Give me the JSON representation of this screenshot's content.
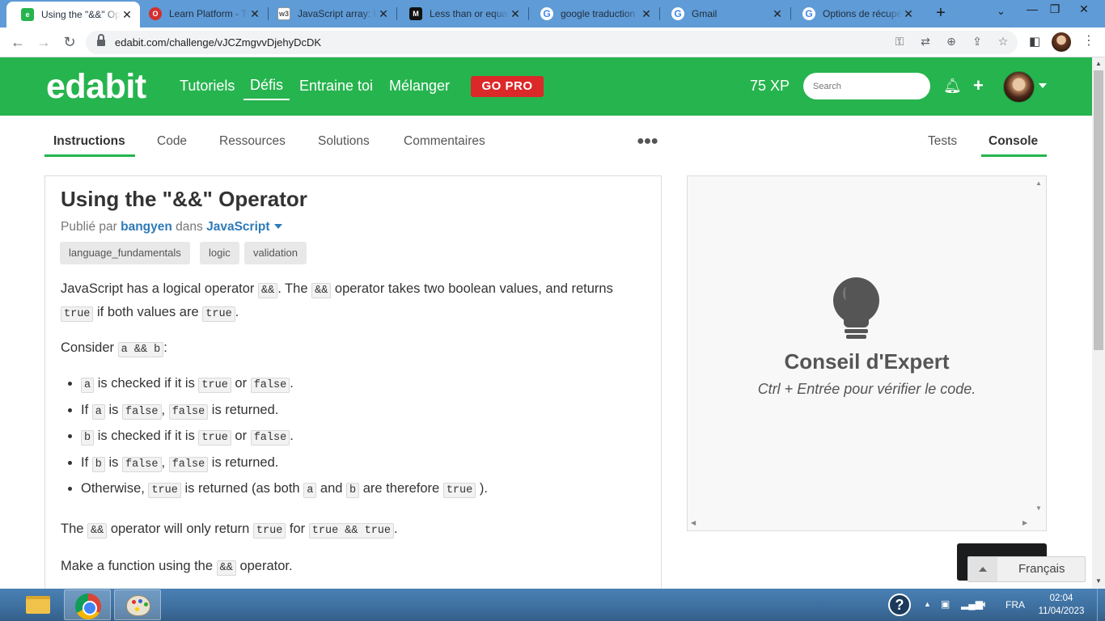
{
  "browser": {
    "tabs": [
      {
        "title": "Using the \"&&\" Operator | edabit",
        "favicon_color": "#26b44e",
        "favicon_glyph": "e",
        "active": true
      },
      {
        "title": "Learn Platform - Third",
        "favicon_color": "#d32f2f",
        "favicon_glyph": "O",
        "active": false
      },
      {
        "title": "JavaScript array: Print",
        "favicon_color": "#9e9e9e",
        "favicon_glyph": "w3",
        "active": false
      },
      {
        "title": "Less than or equal",
        "favicon_color": "#111111",
        "favicon_glyph": "M",
        "active": false
      },
      {
        "title": "google traduction",
        "favicon_color": "#4285f4",
        "favicon_glyph": "G",
        "active": false
      },
      {
        "title": "Gmail",
        "favicon_color": "#4285f4",
        "favicon_glyph": "G",
        "active": false
      },
      {
        "title": "Options de récupération",
        "favicon_color": "#4285f4",
        "favicon_glyph": "G",
        "active": false
      }
    ],
    "url": "edabit.com/challenge/vJCZmgvvDjehyDcDK"
  },
  "site": {
    "logo": "edabit",
    "nav": [
      "Tutoriels",
      "Défis",
      "Entraine toi",
      "Mélanger"
    ],
    "nav_active_index": 1,
    "gopro": "GO PRO",
    "xp": "75 XP",
    "search_placeholder": "Search"
  },
  "subtabs": {
    "left": [
      "Instructions",
      "Code",
      "Ressources",
      "Solutions",
      "Commentaires"
    ],
    "right": [
      "Tests",
      "Console"
    ],
    "active_left": "Instructions",
    "active_right": "Console"
  },
  "challenge": {
    "title": "Using the \"&&\" Operator",
    "published_by_label": "Publié par",
    "author": "bangyen",
    "in_label": "dans",
    "language": "JavaScript",
    "tags": [
      "language_fundamentals",
      "logic",
      "validation"
    ],
    "p1": {
      "a": "JavaScript has a logical operator",
      "code1": "&&",
      "b": ". The",
      "code2": "&&",
      "c": "operator takes two boolean values, and returns",
      "code3": "true",
      "d": "if both values are",
      "code4": "true",
      "e": "."
    },
    "p2": {
      "a": "Consider",
      "code1": "a && b",
      "b": ":"
    },
    "bullets": {
      "b1": {
        "c1": "a",
        "t1": "is checked if it is",
        "c2": "true",
        "t2": "or",
        "c3": "false",
        "t3": "."
      },
      "b2": {
        "t0": "If",
        "c1": "a",
        "t1": "is",
        "c2": "false",
        "t2": ",",
        "c3": "false",
        "t3": "is returned."
      },
      "b3": {
        "c1": "b",
        "t1": "is checked if it is",
        "c2": "true",
        "t2": "or",
        "c3": "false",
        "t3": "."
      },
      "b4": {
        "t0": "If",
        "c1": "b",
        "t1": "is",
        "c2": "false",
        "t2": ",",
        "c3": "false",
        "t3": "is returned."
      },
      "b5": {
        "t0": "Otherwise,",
        "c1": "true",
        "t1": "is returned (as both",
        "c2": "a",
        "t2": "and",
        "c3": "b",
        "t3": "are therefore",
        "c4": "true",
        "t4": ")."
      }
    },
    "p3": {
      "a": "The",
      "code1": "&&",
      "b": "operator will only return",
      "code2": "true",
      "c": "for",
      "code3": "true && true",
      "d": "."
    },
    "p4": {
      "a": "Make a function using the",
      "code1": "&&",
      "b": "operator."
    }
  },
  "console": {
    "tip_title": "Conseil d'Expert",
    "tip_text": "Ctrl + Entrée pour vérifier le code."
  },
  "language_popup": "Français",
  "taskbar": {
    "lang": "FRA",
    "time": "02:04",
    "date": "11/04/2023"
  }
}
